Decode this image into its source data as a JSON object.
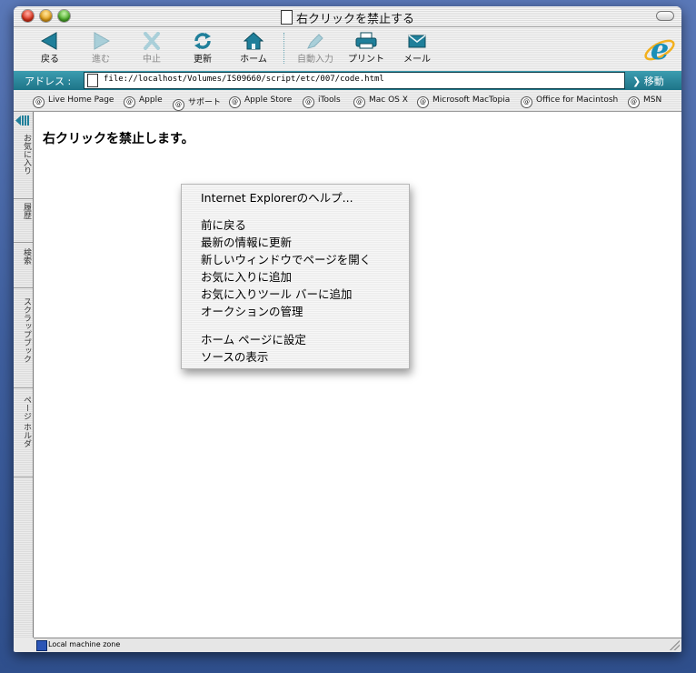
{
  "window": {
    "title": "右クリックを禁止する"
  },
  "toolbar": {
    "back": "戻る",
    "forward": "進む",
    "stop": "中止",
    "refresh": "更新",
    "home": "ホーム",
    "autofill": "自動入力",
    "print": "プリント",
    "mail": "メール"
  },
  "address": {
    "label": "アドレス :",
    "url": "file://localhost/Volumes/IS09660/script/etc/007/code.html",
    "go": "移動"
  },
  "favorites": [
    "Live Home Page",
    "Apple",
    "サポート",
    "Apple Store",
    "iTools",
    "Mac OS X",
    "Microsoft MacTopia",
    "Office for Macintosh",
    "MSN"
  ],
  "sidebar_tabs": [
    "お気に入り",
    "履歴",
    "検索",
    "スクラップブック",
    "ページ ホルダ"
  ],
  "page": {
    "heading": "右クリックを禁止します。"
  },
  "context_menu": {
    "items": [
      "Internet Explorerのヘルプ...",
      "前に戻る",
      "最新の情報に更新",
      "新しいウィンドウでページを開く",
      "お気に入りに追加",
      "お気に入りツール バーに追加",
      "オークションの管理",
      "ホーム ページに設定",
      "ソースの表示"
    ]
  },
  "status": {
    "zone": "Local machine zone"
  },
  "colors": {
    "accent": "#1d7488",
    "desktop": "#3f5f9e"
  }
}
